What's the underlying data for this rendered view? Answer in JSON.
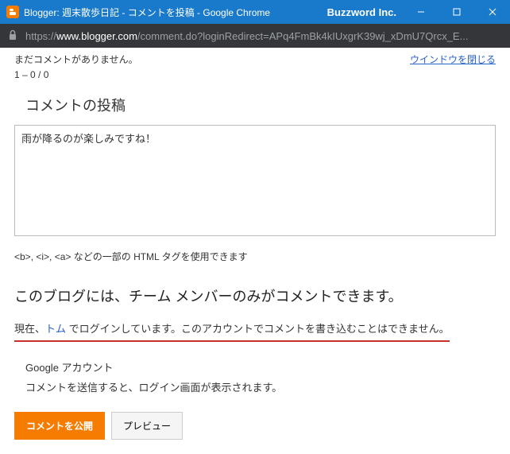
{
  "window": {
    "title": "Blogger: 週末散歩日記 - コメントを投稿 - Google Chrome",
    "company": "Buzzword Inc."
  },
  "address": {
    "prefix": "https://",
    "domain": "www.blogger.com",
    "path": "/comment.do?loginRedirect=APq4FmBk4kIUxgrK39wj_xDmU7Qrcx_E..."
  },
  "top": {
    "no_comments": "まだコメントがありません。",
    "close_window": "ウインドウを閉じる",
    "counter": "1 – 0 / 0"
  },
  "post": {
    "heading": "コメントの投稿",
    "body": "雨が降るのが楽しみですね！",
    "html_hint": "<b>, <i>, <a> などの一部の HTML タグを使用できます"
  },
  "restriction": "このブログには、チーム メンバーのみがコメントできます。",
  "login": {
    "prefix": "現在、",
    "user": "トム",
    "suffix": " でログインしています。このアカウントでコメントを書き込むことはできません。"
  },
  "account": {
    "label": "Google アカウント",
    "note": "コメントを送信すると、ログイン画面が表示されます。"
  },
  "buttons": {
    "publish": "コメントを公開",
    "preview": "プレビュー"
  }
}
